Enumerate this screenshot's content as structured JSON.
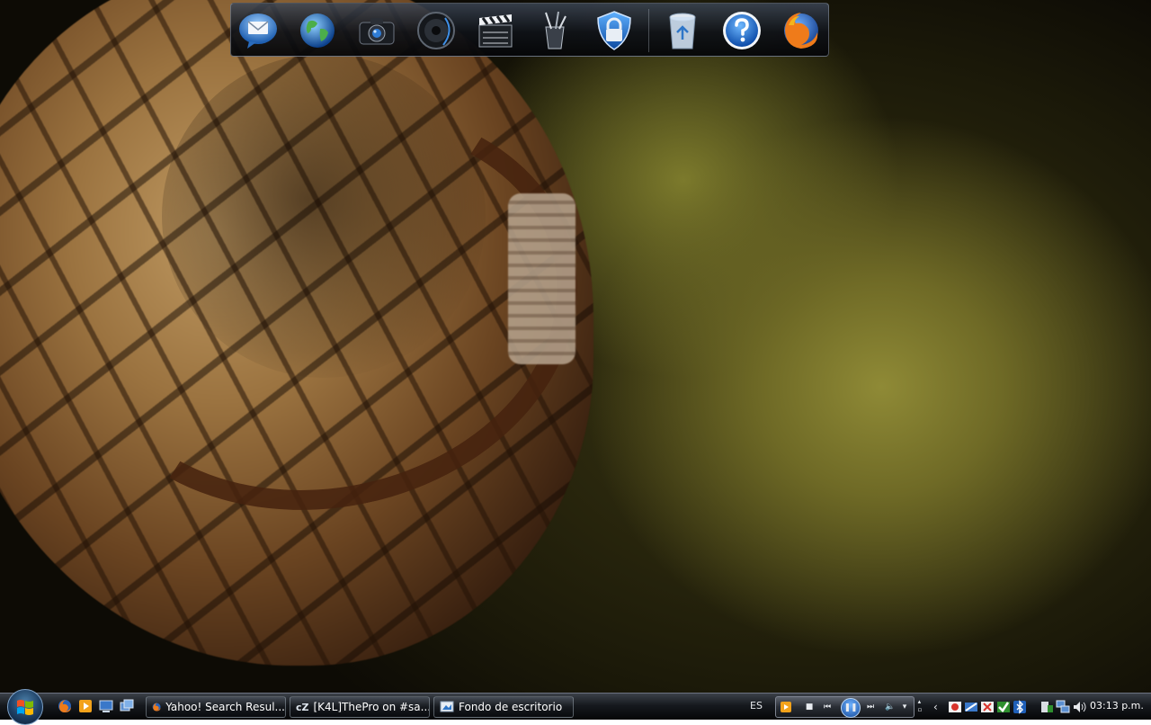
{
  "dock": {
    "items": [
      {
        "name": "mail",
        "icon": "mail-icon"
      },
      {
        "name": "internet",
        "icon": "globe-icon"
      },
      {
        "name": "camera",
        "icon": "camera-icon"
      },
      {
        "name": "music",
        "icon": "speaker-icon"
      },
      {
        "name": "movies",
        "icon": "clapperboard-icon"
      },
      {
        "name": "notes",
        "icon": "pencil-cup-icon"
      },
      {
        "name": "security",
        "icon": "shield-lock-icon"
      },
      {
        "name": "recycle-bin",
        "icon": "recycle-bin-icon"
      },
      {
        "name": "help",
        "icon": "help-icon"
      },
      {
        "name": "firefox",
        "icon": "firefox-icon"
      }
    ]
  },
  "taskbar": {
    "quick_launch": [
      "firefox-icon",
      "media-player-icon",
      "show-desktop-icon",
      "switch-windows-icon"
    ],
    "tasks": [
      {
        "label": "Yahoo! Search Resul...",
        "icon": "firefox-icon"
      },
      {
        "label": "[K4L]ThePro on #sa...",
        "icon": "irc-client-icon"
      },
      {
        "label": "Fondo de escritorio",
        "icon": "desktop-background-icon"
      }
    ],
    "language": "ES",
    "clock": "03:13 p.m."
  },
  "colors": {
    "accent": "#1f6fc7",
    "taskbar": "#16191e"
  }
}
